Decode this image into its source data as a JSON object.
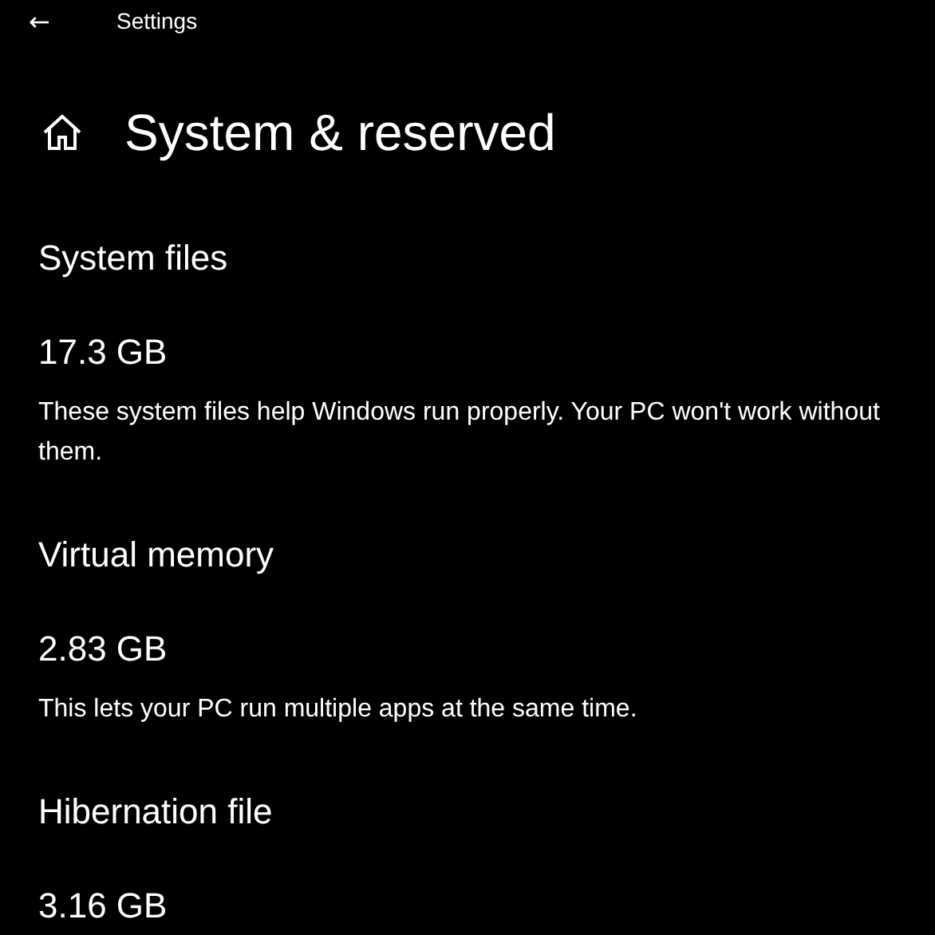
{
  "title_bar": {
    "back": "←",
    "title": "Settings"
  },
  "page": {
    "title": "System & reserved"
  },
  "sections": [
    {
      "heading": "System files",
      "size": "17.3 GB",
      "description": "These system files help Windows run properly. Your PC won't work without them."
    },
    {
      "heading": "Virtual memory",
      "size": "2.83 GB",
      "description": "This lets your PC run multiple apps at the same time."
    },
    {
      "heading": "Hibernation file",
      "size": "3.16 GB"
    }
  ]
}
